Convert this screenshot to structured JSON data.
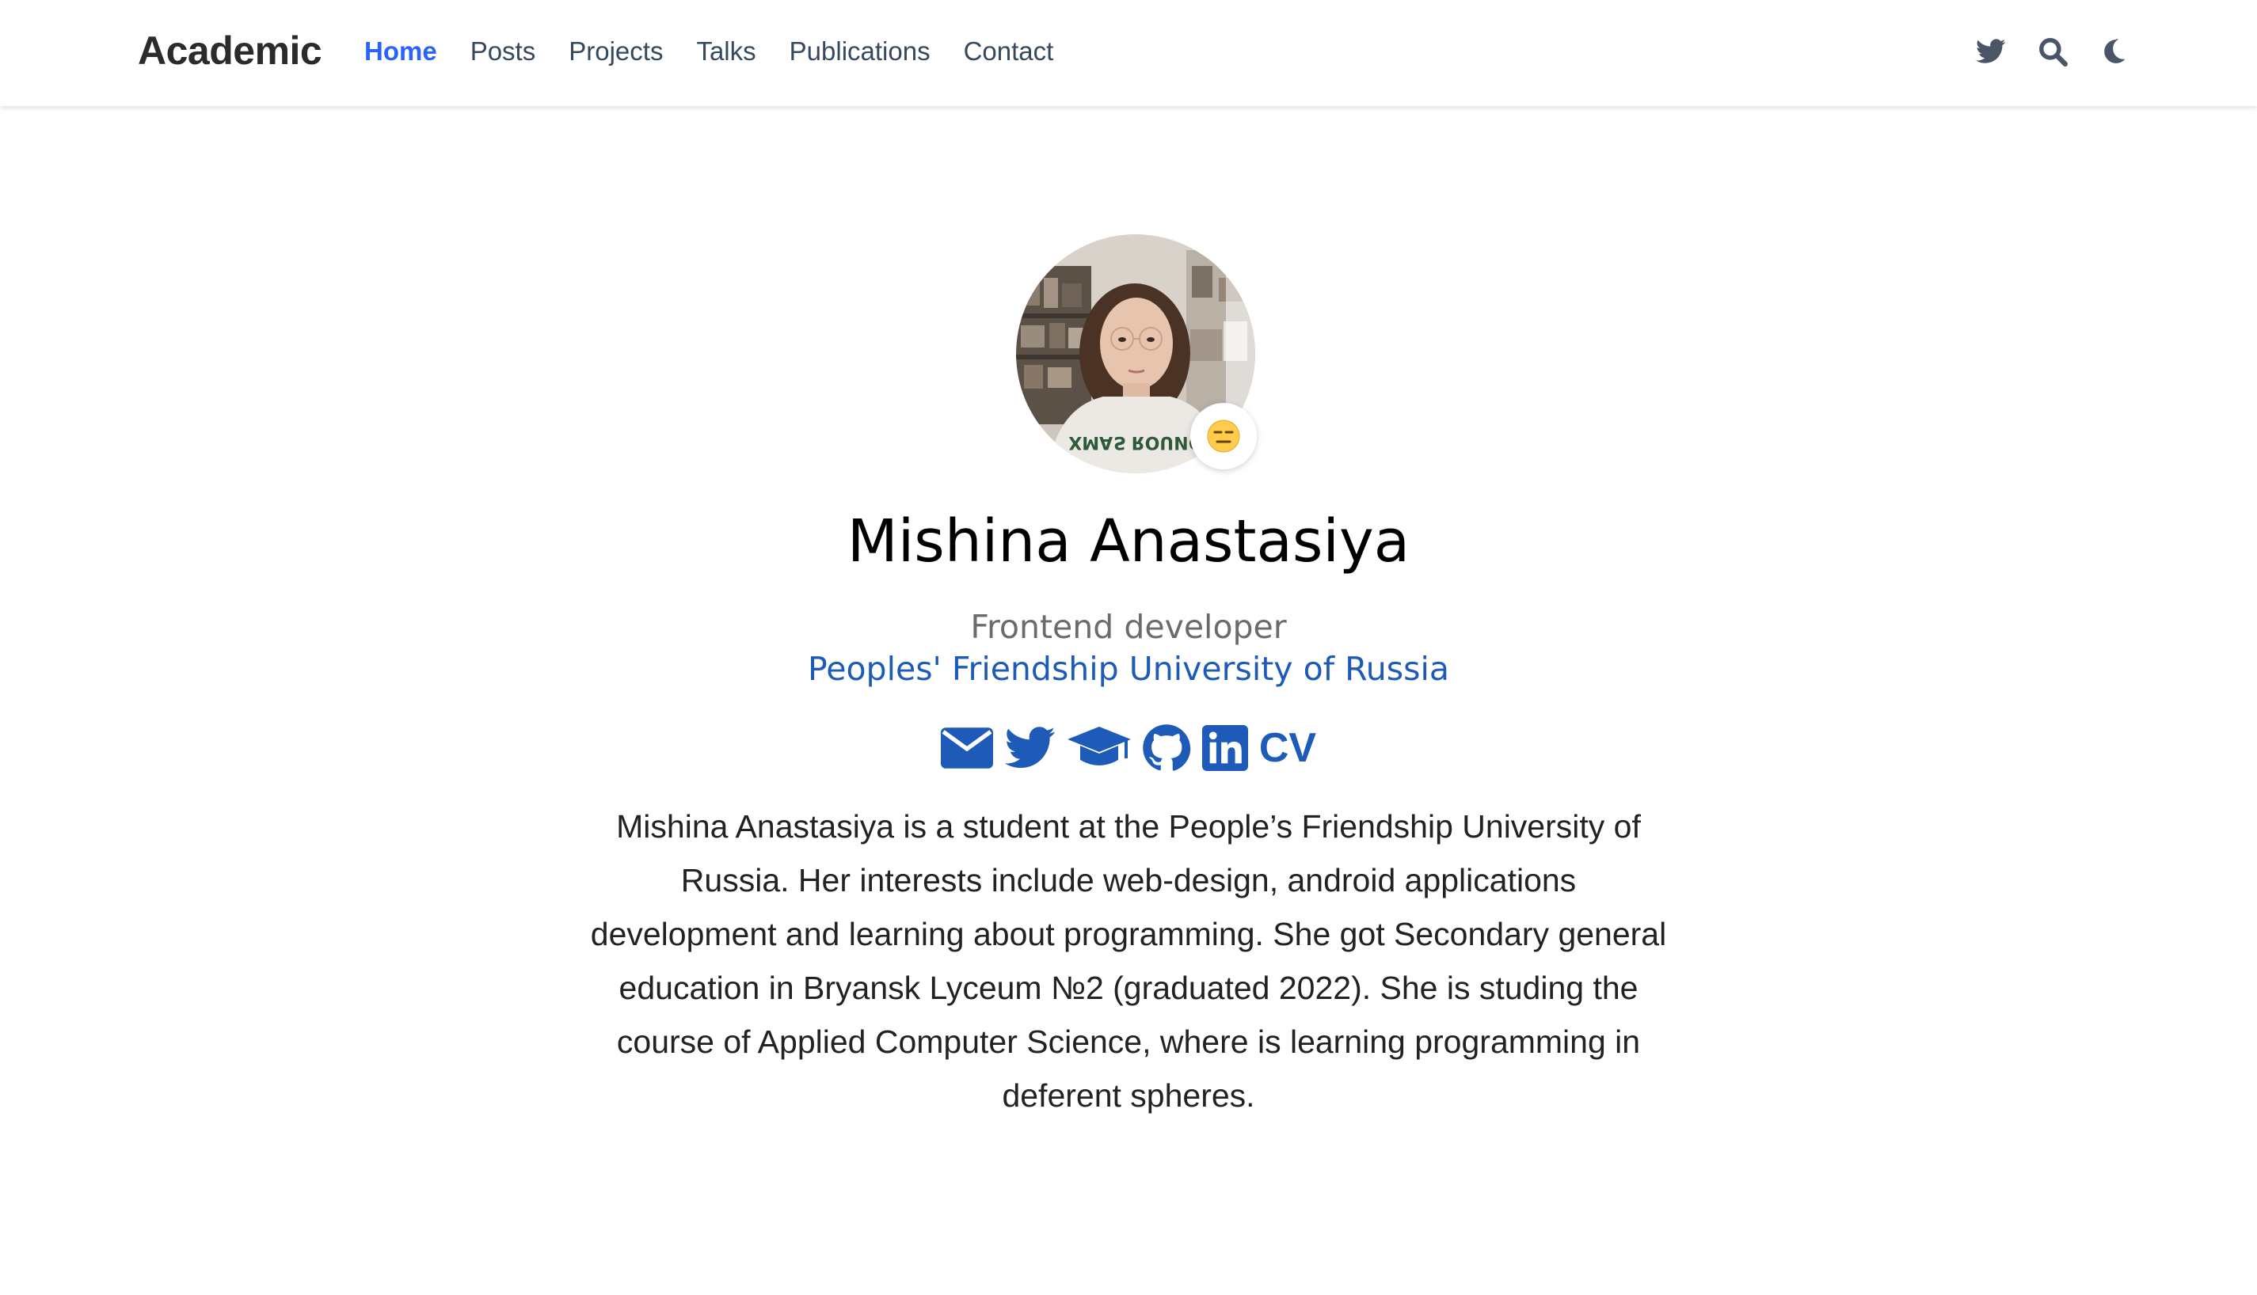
{
  "navbar": {
    "brand": "Academic",
    "links": [
      {
        "label": "Home",
        "active": true
      },
      {
        "label": "Posts",
        "active": false
      },
      {
        "label": "Projects",
        "active": false
      },
      {
        "label": "Talks",
        "active": false
      },
      {
        "label": "Publications",
        "active": false
      },
      {
        "label": "Contact",
        "active": false
      }
    ],
    "tools": [
      "twitter-icon",
      "search-icon",
      "moon-icon"
    ]
  },
  "profile": {
    "name": "Mishina Anastasiya",
    "role": "Frontend developer",
    "organization": "Peoples' Friendship University of Russia",
    "status_emoji": "😑",
    "social": [
      {
        "icon": "envelope-icon"
      },
      {
        "icon": "twitter-icon"
      },
      {
        "icon": "graduation-cap-icon"
      },
      {
        "icon": "github-icon"
      },
      {
        "icon": "linkedin-icon"
      },
      {
        "icon": "cv-icon",
        "label": "CV"
      }
    ],
    "bio": "Mishina Anastasiya is a student at the People’s Friendship University of Russia. Her interests include web-design, android applications development and learning about programming. She got Secondary general education in Bryansk Lyceum №2 (graduated 2022). She is studing the course of Applied Computer Science, where is learning programming in deferent spheres."
  },
  "colors": {
    "accent": "#1e5bb8",
    "nav_active": "#2962ff",
    "nav_text": "#34495e",
    "icon_gray": "#4a5568"
  }
}
